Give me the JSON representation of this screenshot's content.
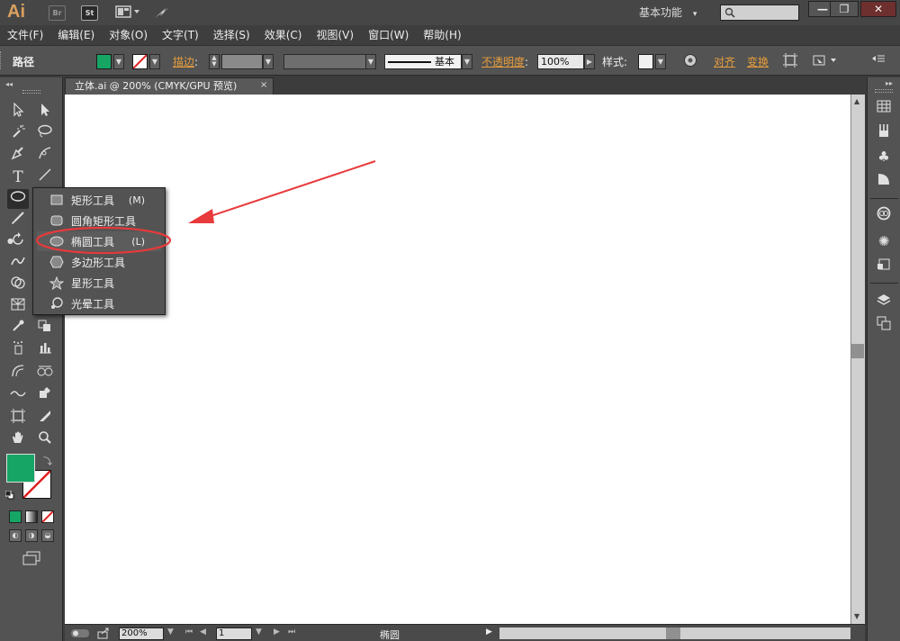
{
  "titlebar": {
    "logo": "Ai",
    "bridge_badge": "Br",
    "stock_badge": "St",
    "workspace": "基本功能",
    "workspace_arrow": "▾",
    "search_placeholder": "",
    "minimize": "—",
    "restore": "❐",
    "close": "✕"
  },
  "menubar": {
    "items": [
      "文件(F)",
      "编辑(E)",
      "对象(O)",
      "文字(T)",
      "选择(S)",
      "效果(C)",
      "视图(V)",
      "窗口(W)",
      "帮助(H)"
    ]
  },
  "controlbar": {
    "selection_type": "路径",
    "fill_color": "#17a566",
    "stroke_label": "描边",
    "stroke_colon": ":",
    "brush_label": "基本",
    "opacity_label": "不透明度",
    "opacity_colon": ":",
    "opacity_value": "100%",
    "style_label": "样式",
    "style_colon": ":",
    "align_label": "对齐",
    "transform_label": "变换"
  },
  "document": {
    "tab_title": "立体.ai @ 200% (CMYK/GPU 预览)",
    "tab_close": "×"
  },
  "toolbar": {
    "collapse": "◂◂",
    "fill_color": "#17a566",
    "stroke_color": "#ffffff"
  },
  "flyout": {
    "items": [
      {
        "label": "矩形工具",
        "shortcut": "(M)",
        "icon": "rectangle-icon"
      },
      {
        "label": "圆角矩形工具",
        "shortcut": "",
        "icon": "rounded-rectangle-icon"
      },
      {
        "label": "椭圆工具",
        "shortcut": "(L)",
        "icon": "ellipse-icon"
      },
      {
        "label": "多边形工具",
        "shortcut": "",
        "icon": "polygon-icon"
      },
      {
        "label": "星形工具",
        "shortcut": "",
        "icon": "star-icon"
      },
      {
        "label": "光晕工具",
        "shortcut": "",
        "icon": "flare-icon"
      }
    ],
    "highlight_color": "#e8393b"
  },
  "statusbar": {
    "zoom": "200%",
    "artboard": "1",
    "status_text": "椭圆"
  },
  "annotation": {
    "color": "#e8393b"
  }
}
